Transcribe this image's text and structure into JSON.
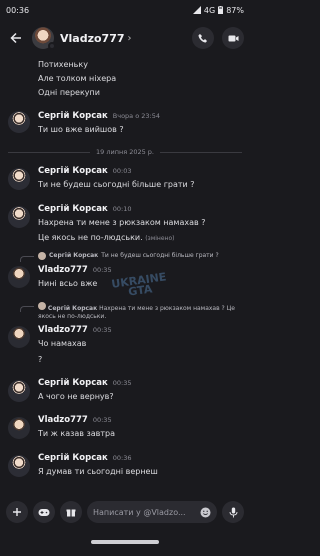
{
  "status_bar": {
    "time": "00:36",
    "network": "4G",
    "battery": "87%"
  },
  "header": {
    "title": "Vladzo777"
  },
  "messages": {
    "prev_lines": [
      "Потихеньку",
      "Але толком ніхера",
      "Одні перекупи"
    ],
    "m1": {
      "author": "Сергій Корсак",
      "time": "Вчора о 23:54",
      "text": "Ти шо вже вийшов ?"
    },
    "date_divider": "19 липня 2025 р.",
    "m2": {
      "author": "Сергій Корсак",
      "time": "00:03",
      "text": "Ти не будеш сьогодні більше грати ?"
    },
    "m3": {
      "author": "Сергій Корсак",
      "time": "00:10",
      "line1": "Нахрена ти мене з рюкзаком намахав ?",
      "line2": "Це якось не по-людськи.",
      "edited": "(змінено)"
    },
    "m4": {
      "reply_author": "Сергій Корсак",
      "reply_text": "Ти не будеш сьогодні більше грати ?",
      "author": "Vladzo777",
      "time": "00:35",
      "text": "Нині всьо вже"
    },
    "m5": {
      "reply_author": "Сергій Корсак",
      "reply_text": "Нахрена ти мене з рюкзаком намахав ?  Це",
      "reply_text2": "якось не по-людськи.",
      "author": "Vladzo777",
      "time": "00:35",
      "line1": "Чо намахав",
      "line2": "?"
    },
    "m6": {
      "author": "Сергій Корсак",
      "time": "00:35",
      "text": "А чого не вернув?"
    },
    "m7": {
      "author": "Vladzo777",
      "time": "00:35",
      "text": "Ти ж казав завтра"
    },
    "m8": {
      "author": "Сергій Корсак",
      "time": "00:36",
      "text": "Я думав ти сьогодні вернеш"
    }
  },
  "watermark": {
    "line1": "UKRAINE",
    "line2": "GTA"
  },
  "input": {
    "placeholder": "Написати у @Vladzo..."
  },
  "colors": {
    "background": "#1a1a1e",
    "surface": "#2b2b31",
    "muted_text": "#8c8c95"
  }
}
